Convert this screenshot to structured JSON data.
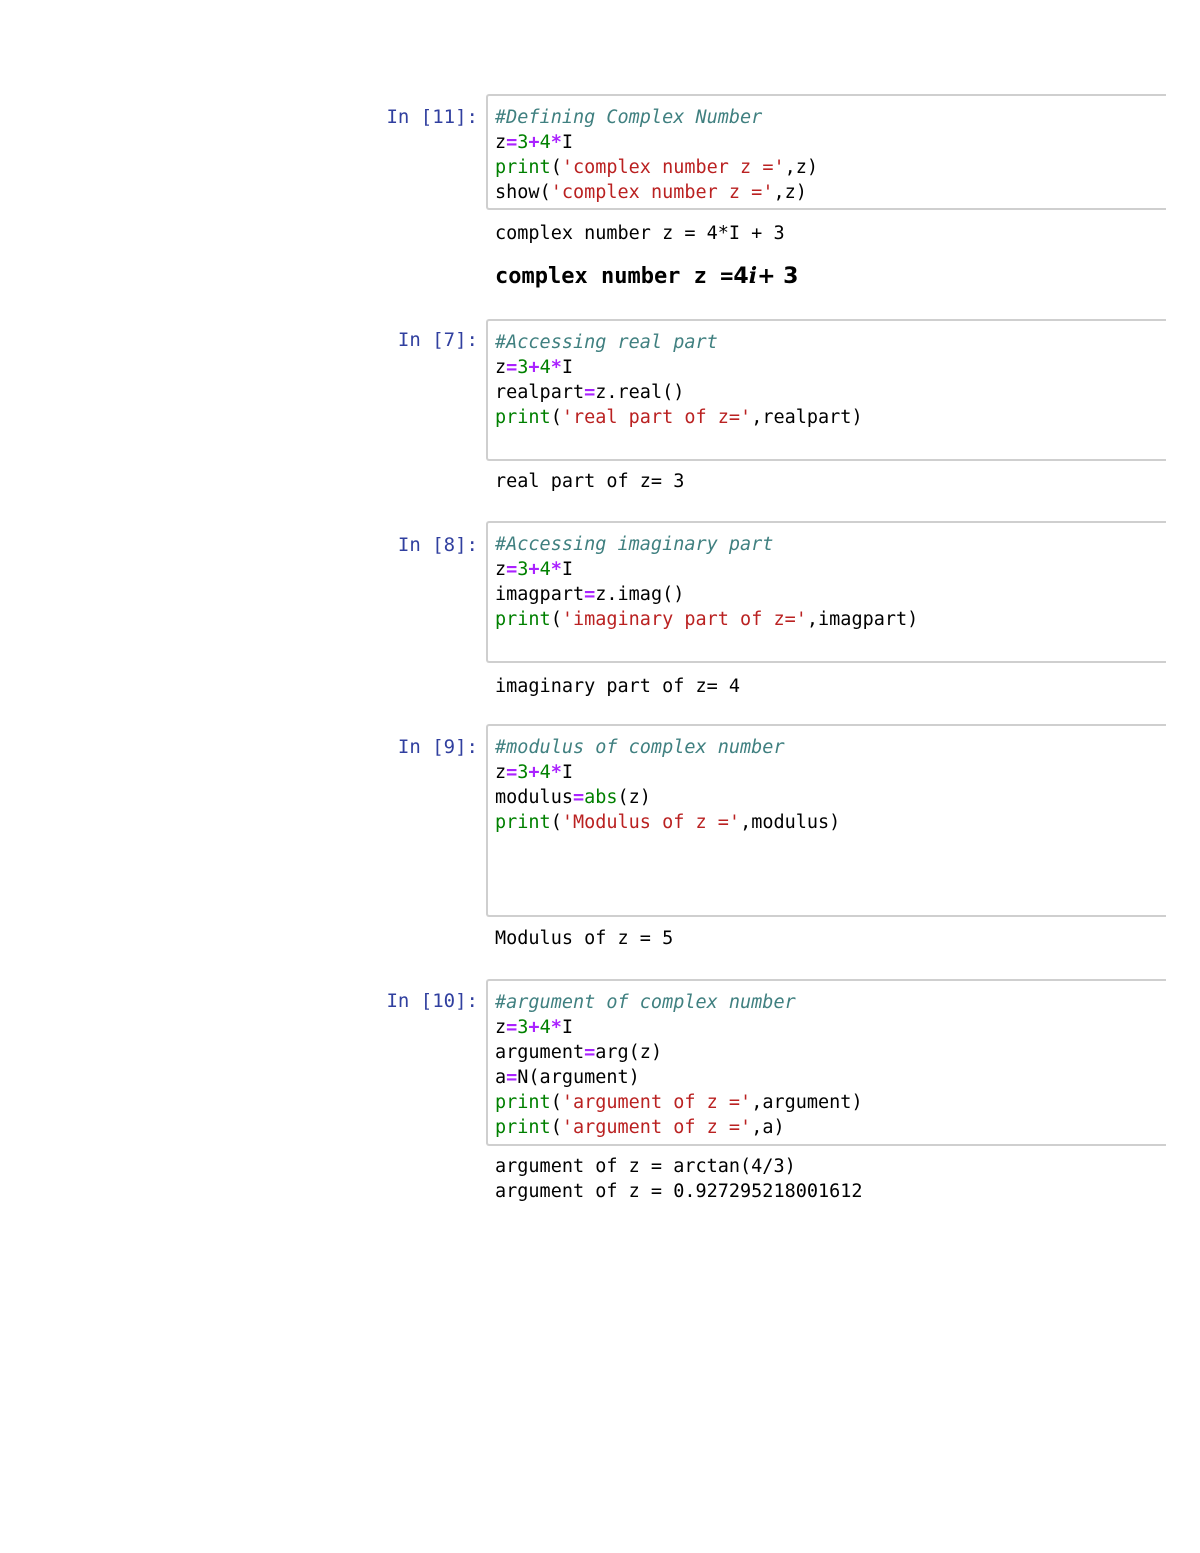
{
  "cells": [
    {
      "prompt": "In [11]:",
      "code": {
        "line1": "#Defining Complex Number",
        "line2": {
          "a": "z",
          "eq": "=",
          "n1": "3",
          "plus": "+",
          "n2": "4",
          "star": "*",
          "v": "I"
        },
        "line3": {
          "fn": "print",
          "open": "(",
          "str": "'complex number z ='",
          "rest": ",z)"
        },
        "line4": {
          "fn": "show",
          "open": "(",
          "str": "'complex number z ='",
          "rest": ",z)"
        }
      },
      "output": [
        "complex number z = 4*I + 3"
      ],
      "math_output": {
        "text": "complex number z =",
        "num": "4",
        "var": "i",
        "rest": "+ 3"
      }
    },
    {
      "prompt": "In [7]:",
      "code": {
        "line1": "#Accessing real part",
        "line2": {
          "a": "z",
          "eq": "=",
          "n1": "3",
          "plus": "+",
          "n2": "4",
          "star": "*",
          "v": "I"
        },
        "line3": {
          "a": "realpart",
          "eq": "=",
          "rest": "z.real()"
        },
        "line4": {
          "fn": "print",
          "open": "(",
          "str": "'real part of z='",
          "rest": ",realpart)"
        }
      },
      "output": [
        "real part of z= 3"
      ]
    },
    {
      "prompt": "In [8]:",
      "code": {
        "line1": "#Accessing imaginary part",
        "line2": {
          "a": "z",
          "eq": "=",
          "n1": "3",
          "plus": "+",
          "n2": "4",
          "star": "*",
          "v": "I"
        },
        "line3": {
          "a": "imagpart",
          "eq": "=",
          "rest": "z.imag()"
        },
        "line4": {
          "fn": "print",
          "open": "(",
          "str": "'imaginary part of z='",
          "rest": ",imagpart)"
        }
      },
      "output": [
        "imaginary part of z= 4"
      ]
    },
    {
      "prompt": "In [9]:",
      "code": {
        "line1": "#modulus of complex number",
        "line2": {
          "a": "z",
          "eq": "=",
          "n1": "3",
          "plus": "+",
          "n2": "4",
          "star": "*",
          "v": "I"
        },
        "line3": {
          "a": "modulus",
          "eq": "=",
          "fn": "abs",
          "rest": "(z)"
        },
        "line4": {
          "fn": "print",
          "open": "(",
          "str": "'Modulus of z ='",
          "rest": ",modulus)"
        }
      },
      "output": [
        "Modulus of z = 5"
      ]
    },
    {
      "prompt": "In [10]:",
      "code": {
        "line1": "#argument of complex number",
        "line2": {
          "a": "z",
          "eq": "=",
          "n1": "3",
          "plus": "+",
          "n2": "4",
          "star": "*",
          "v": "I"
        },
        "line3": {
          "a": "argument",
          "eq": "=",
          "rest": "arg(z)"
        },
        "line4": {
          "a": "a",
          "eq": "=",
          "rest": "N(argument)"
        },
        "line5": {
          "fn": "print",
          "open": "(",
          "str": "'argument of z ='",
          "rest": ",argument)"
        },
        "line6": {
          "fn": "print",
          "open": "(",
          "str": "'argument of z ='",
          "rest": ",a)"
        }
      },
      "output": [
        "argument of z = arctan(4/3)",
        "argument of z = 0.927295218001612"
      ]
    }
  ]
}
